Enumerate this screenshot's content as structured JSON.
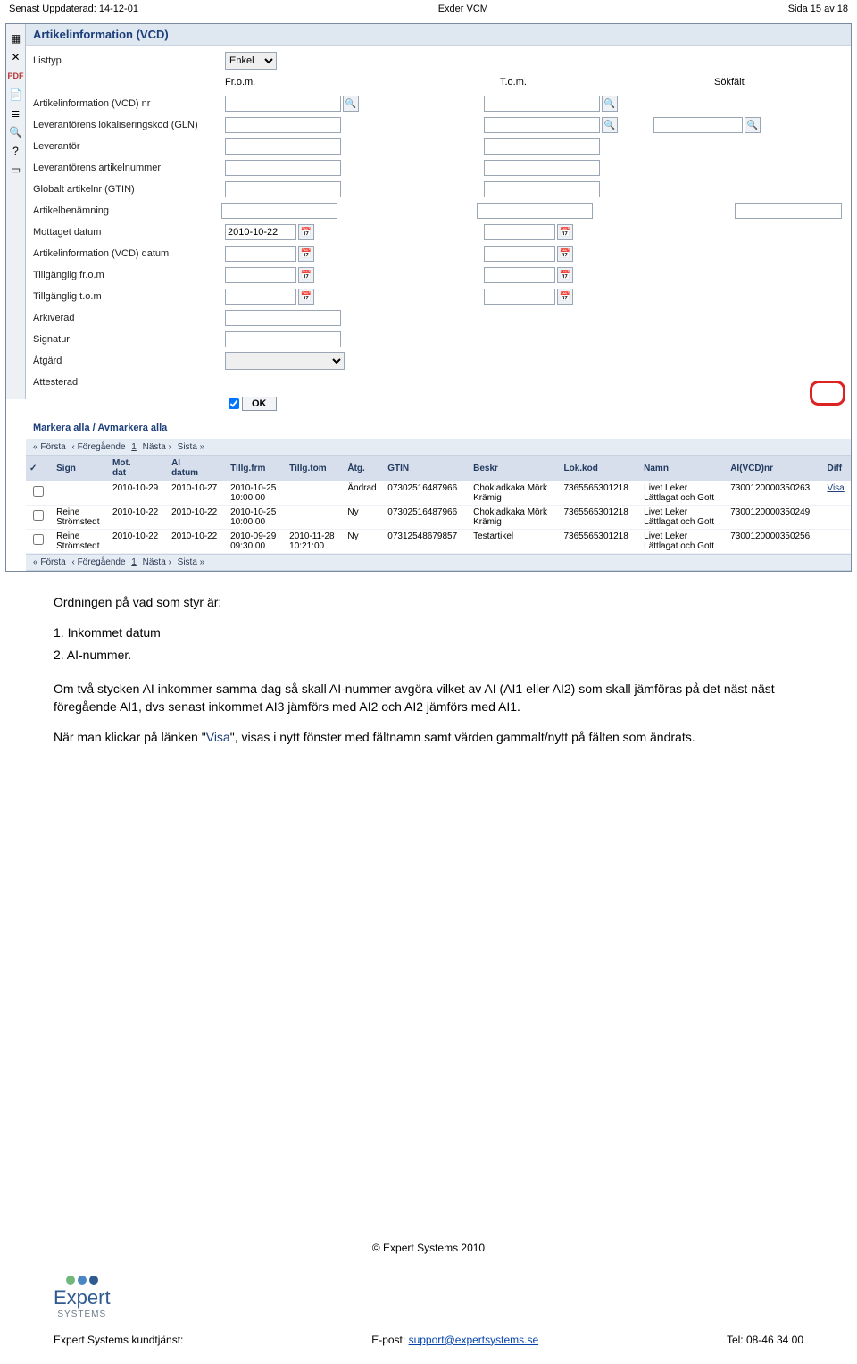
{
  "header": {
    "left": "Senast Uppdaterad: 14-12-01",
    "center": "Exder VCM",
    "right": "Sida 15 av 18"
  },
  "app": {
    "title": "Artikelinformation (VCD)",
    "labels": {
      "listtyp": "Listtyp",
      "listtyp_value": "Enkel",
      "from": "Fr.o.m.",
      "tom": "T.o.m.",
      "sokfalt": "Sökfält",
      "ai_nr": "Artikelinformation (VCD) nr",
      "lev_glm": "Leverantörens lokaliseringskod (GLN)",
      "leverantor": "Leverantör",
      "lev_artnr": "Leverantörens artikelnummer",
      "gtin": "Globalt artikelnr (GTIN)",
      "artben": "Artikelbenämning",
      "mottaget": "Mottaget datum",
      "mottaget_value": "2010-10-22",
      "ai_datum": "Artikelinformation (VCD) datum",
      "till_from": "Tillgänglig fr.o.m",
      "till_tom": "Tillgänglig t.o.m",
      "arkiverad": "Arkiverad",
      "signatur": "Signatur",
      "atgard": "Åtgärd",
      "attesterad": "Attesterad",
      "ok": "OK"
    },
    "mark": {
      "all": "Markera alla",
      "sep": " / ",
      "none": "Avmarkera alla"
    },
    "pager": {
      "first": "« Första",
      "prev": "‹ Föregående",
      "page": "1",
      "next": "Nästa ›",
      "last": "Sista »"
    },
    "grid": {
      "headers": [
        "✓",
        "Sign",
        "Mot.\ndat",
        "AI\ndatum",
        "Tillg.frm",
        "Tillg.tom",
        "Åtg.",
        "GTIN",
        "Beskr",
        "Lok.kod",
        "Namn",
        "AI(VCD)nr",
        "Diff"
      ],
      "rows": [
        {
          "sign": "",
          "mot": "2010-10-29",
          "ai": "2010-10-27",
          "frm": "2010-10-25\n10:00:00",
          "tom": "",
          "atg": "Ändrad",
          "gtin": "07302516487966",
          "beskr": "Chokladkaka Mörk\nKrämig",
          "lok": "7365565301218",
          "namn": "Livet Leker\nLättlagat och Gott",
          "ainr": "7300120000350263",
          "diff": "Visa"
        },
        {
          "sign": "Reine\nStrömstedt",
          "mot": "2010-10-22",
          "ai": "2010-10-22",
          "frm": "2010-10-25\n10:00:00",
          "tom": "",
          "atg": "Ny",
          "gtin": "07302516487966",
          "beskr": "Chokladkaka Mörk\nKrämig",
          "lok": "7365565301218",
          "namn": "Livet Leker\nLättlagat och Gott",
          "ainr": "7300120000350249",
          "diff": ""
        },
        {
          "sign": "Reine\nStrömstedt",
          "mot": "2010-10-22",
          "ai": "2010-10-22",
          "frm": "2010-09-29\n09:30:00",
          "tom": "2010-11-28\n10:21:00",
          "atg": "Ny",
          "gtin": "07312548679857",
          "beskr": "Testartikel",
          "lok": "7365565301218",
          "namn": "Livet Leker\nLättlagat och Gott",
          "ainr": "7300120000350256",
          "diff": ""
        }
      ]
    }
  },
  "text": {
    "p1": "Ordningen på vad som styr är:",
    "li1": "1. Inkommet datum",
    "li2": "2. AI-nummer.",
    "p2a": "Om två stycken AI inkommer samma dag så skall AI-nummer avgöra vilket av AI (AI1 eller AI2) som skall jämföras på det näst näst föregående AI1, dvs senast inkommet AI3 jämförs med AI2 och AI2 jämförs med AI1.",
    "p2b_pre": "När man klickar på länken ",
    "p2b_quote_open": "\"",
    "p2b_visa": "Visa",
    "p2b_quote_close": "\"",
    "p2b_post": ", visas i nytt fönster med fältnamn samt värden gammalt/nytt på fälten som ändrats."
  },
  "footer": {
    "copyright": "© Expert Systems 2010",
    "logo_main": "Expert",
    "logo_sub": "SYSTEMS",
    "left": "Expert Systems kundtjänst:",
    "mid_label": "E-post: ",
    "mid_link": "support@expertsystems.se",
    "right": "Tel: 08-46 34 00"
  }
}
